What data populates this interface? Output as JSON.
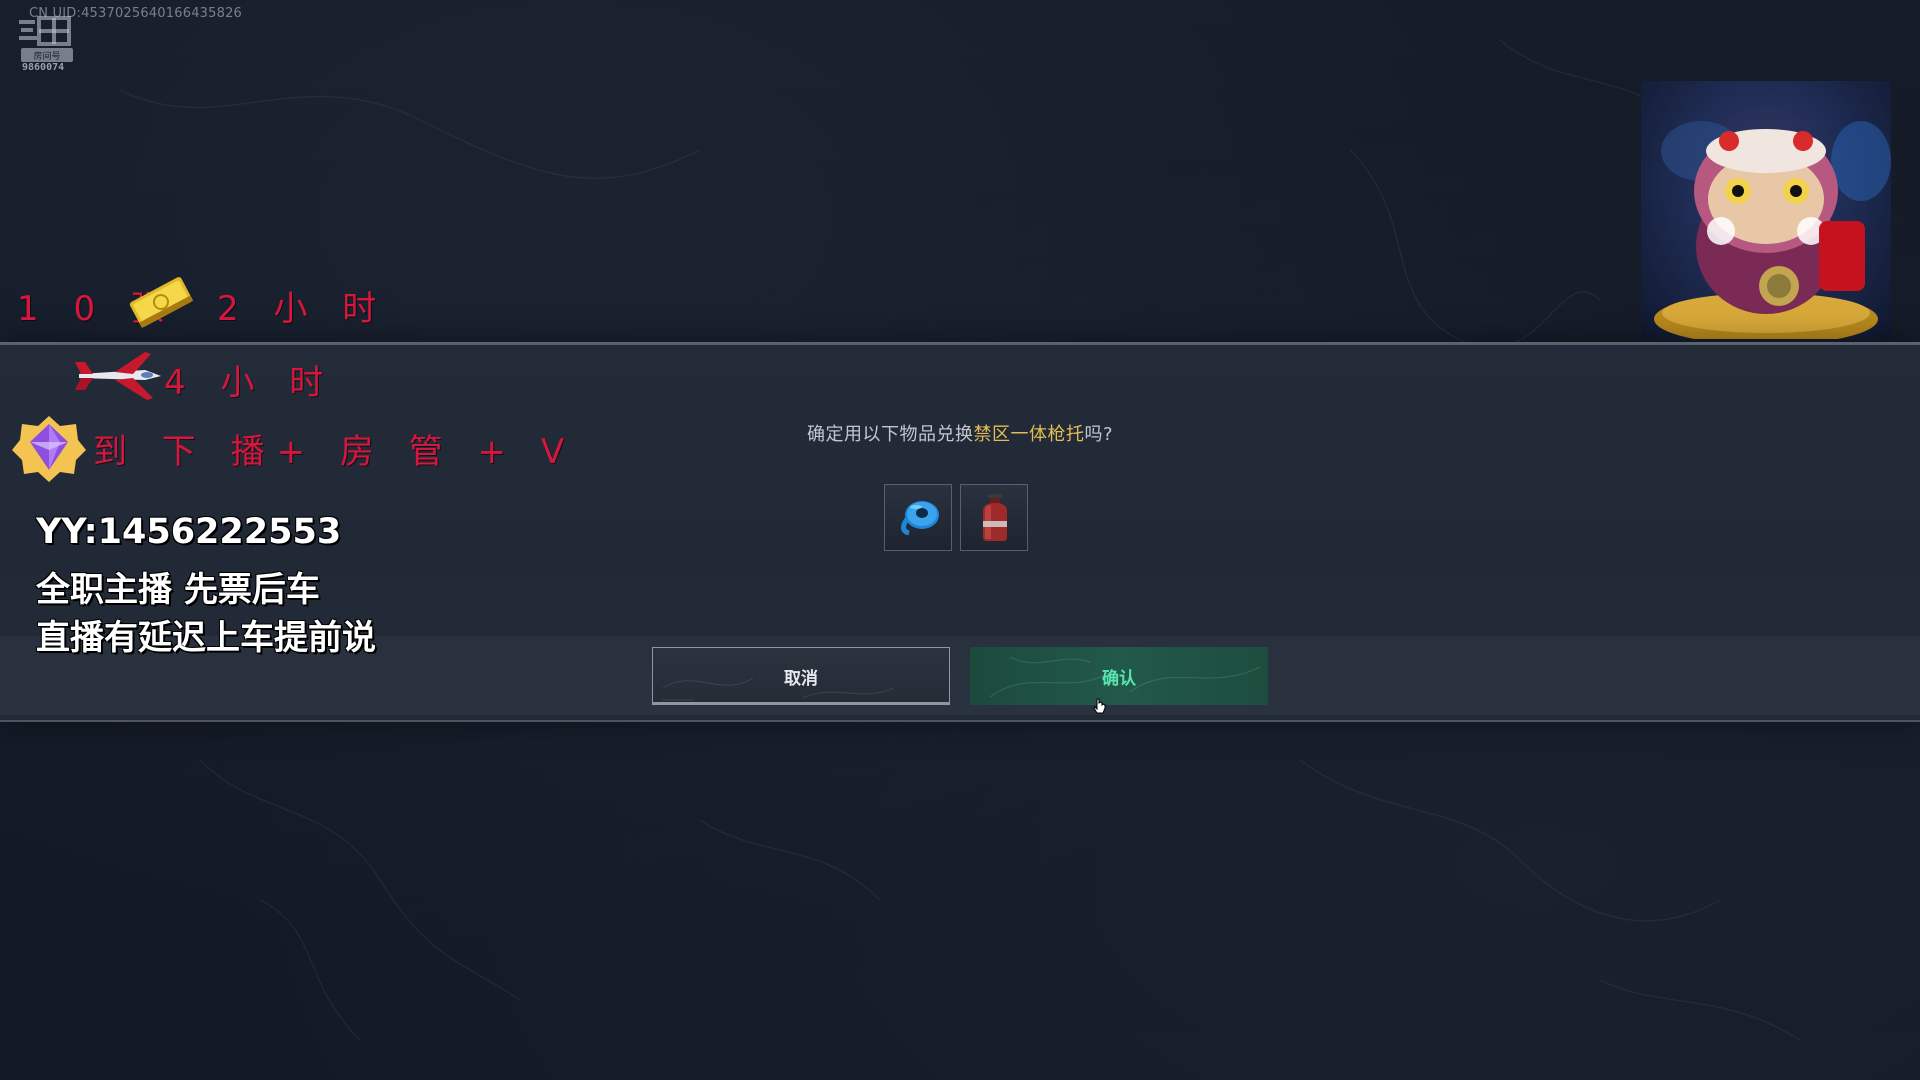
{
  "overlay": {
    "uid_text": "CN UID:4537025640166435826",
    "room_number": "9860074",
    "promo": {
      "line1_prefix": "1 0 张",
      "line1_suffix": "2 小 时",
      "line2_suffix": "4 小 时",
      "line3_suffix": "到 下 播+ 房 管 + V"
    },
    "info": {
      "line1": "YY:1456222553",
      "line2": "全职主播 先票后车",
      "line3": "直播有延迟上车提前说"
    },
    "icons": {
      "watermark": "douyu-logo-icon",
      "ticket": "gold-ticket-icon",
      "plane": "red-jet-icon",
      "badge": "purple-diamond-badge-icon"
    }
  },
  "dialog": {
    "message_prefix": "确定用以下物品兑换",
    "message_item": "禁区一体枪托",
    "message_suffix": "吗?",
    "items": [
      {
        "name": "blue-tape-roll-icon"
      },
      {
        "name": "gas-canister-icon"
      }
    ],
    "cancel_label": "取消",
    "confirm_label": "确认"
  },
  "colors": {
    "highlight": "#e2be54",
    "promo_red": "#d5163d",
    "confirm_green_bg": "#22594a",
    "confirm_green_text": "#57e6b0",
    "background": "#141a26"
  }
}
